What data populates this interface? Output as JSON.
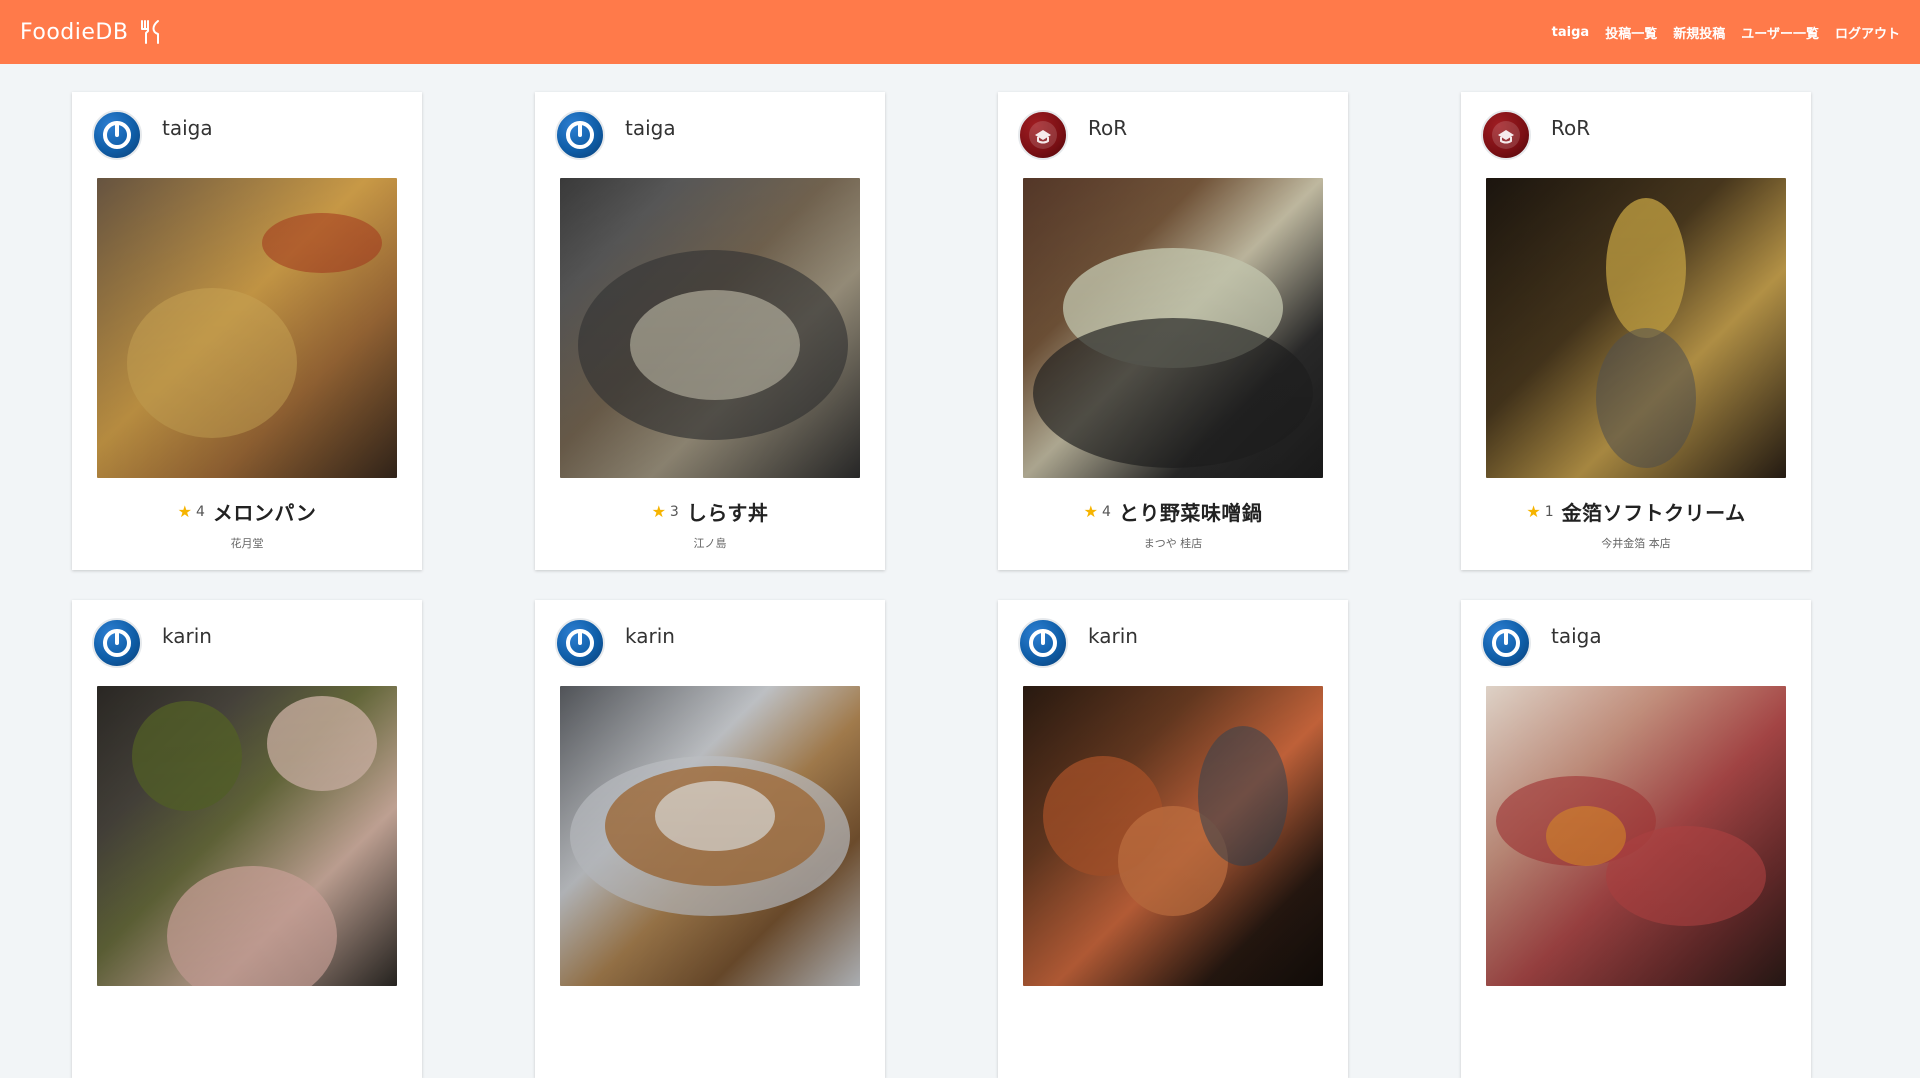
{
  "header": {
    "brand": "FoodieDB",
    "brand_icon": "fork-knife-icon",
    "nav": [
      {
        "label": "taiga"
      },
      {
        "label": "投稿一覧"
      },
      {
        "label": "新規投稿"
      },
      {
        "label": "ユーザー一覧"
      },
      {
        "label": "ログアウト"
      }
    ]
  },
  "posts": [
    {
      "user": "taiga",
      "avatar_style": "blue",
      "rating": "4",
      "title": "メロンパン",
      "place": "花月堂"
    },
    {
      "user": "taiga",
      "avatar_style": "blue",
      "rating": "3",
      "title": "しらす丼",
      "place": "江ノ島"
    },
    {
      "user": "RoR",
      "avatar_style": "red",
      "rating": "4",
      "title": "とり野菜味噌鍋",
      "place": "まつや 桂店"
    },
    {
      "user": "RoR",
      "avatar_style": "red",
      "rating": "1",
      "title": "金箔ソフトクリーム",
      "place": "今井金箔 本店"
    },
    {
      "user": "karin",
      "avatar_style": "blue"
    },
    {
      "user": "karin",
      "avatar_style": "blue"
    },
    {
      "user": "karin",
      "avatar_style": "blue"
    },
    {
      "user": "taiga",
      "avatar_style": "blue"
    }
  ],
  "colors": {
    "header_bg": "#ff7a4a",
    "page_bg": "#f2f5f7",
    "star": "#f6b400"
  }
}
